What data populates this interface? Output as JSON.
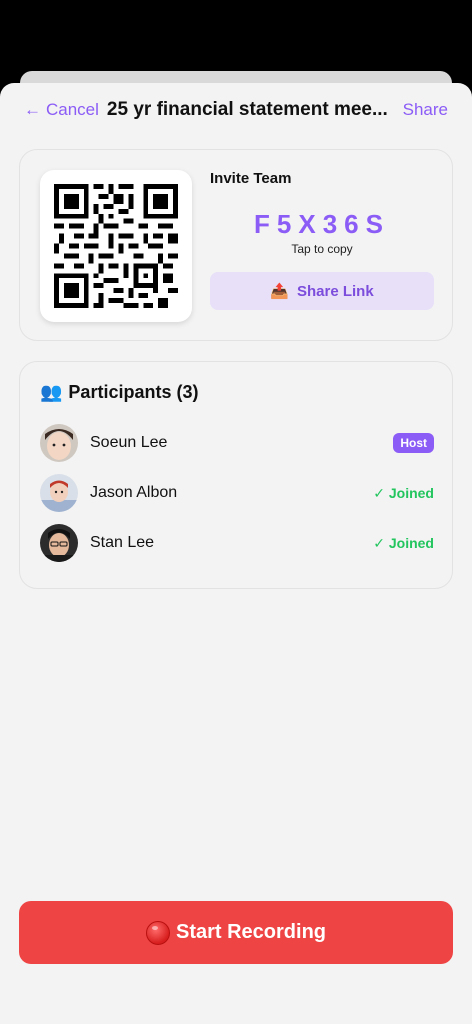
{
  "header": {
    "cancel_label": "Cancel",
    "title": "25 yr financial statement mee...",
    "share_label": "Share"
  },
  "invite": {
    "title": "Invite Team",
    "code": "F5X36S",
    "tap_hint": "Tap to copy",
    "share_link_label": "Share Link",
    "share_link_icon": "outbox-tray-icon"
  },
  "participants": {
    "header": "Participants (3)",
    "header_icon": "busts-icon",
    "items": [
      {
        "name": "Soeun Lee",
        "status": "Host",
        "avatar": "avatar-photo-child"
      },
      {
        "name": "Jason Albon",
        "status": "✓ Joined",
        "avatar": "avatar-photo-baby"
      },
      {
        "name": "Stan Lee",
        "status": "✓ Joined",
        "avatar": "avatar-photo-man"
      }
    ]
  },
  "actions": {
    "start_recording_label": "Start Recording",
    "start_recording_icon": "red-circle-icon"
  },
  "colors": {
    "accent": "#8b5cf6",
    "joined": "#22c55e",
    "record": "#ef4444",
    "share_link_bg": "#e7e0f8"
  }
}
